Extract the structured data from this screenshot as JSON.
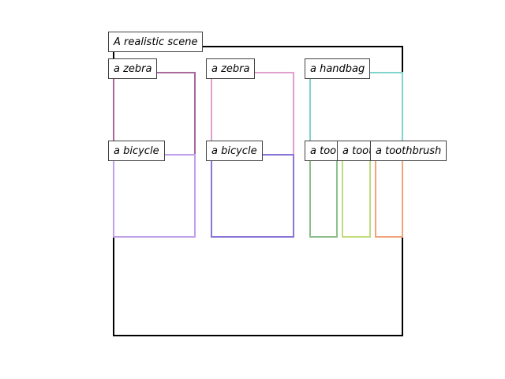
{
  "scene": {
    "label": "A realistic scene",
    "frame_color": "#000000"
  },
  "objects": [
    {
      "label": "a zebra",
      "color": "#a8689a"
    },
    {
      "label": "a zebra",
      "color": "#e0a0cc"
    },
    {
      "label": "a handbag",
      "color": "#80d4cc"
    },
    {
      "label": "a bicycle",
      "color": "#c0a0ea"
    },
    {
      "label": "a bicycle",
      "color": "#8a74d8"
    },
    {
      "label": "a toothbrush",
      "color": "#8cbf8c"
    },
    {
      "label": "a toothbrush",
      "color": "#c0dc7c"
    },
    {
      "label": "a toothbrush",
      "color": "#f0a47c"
    }
  ]
}
